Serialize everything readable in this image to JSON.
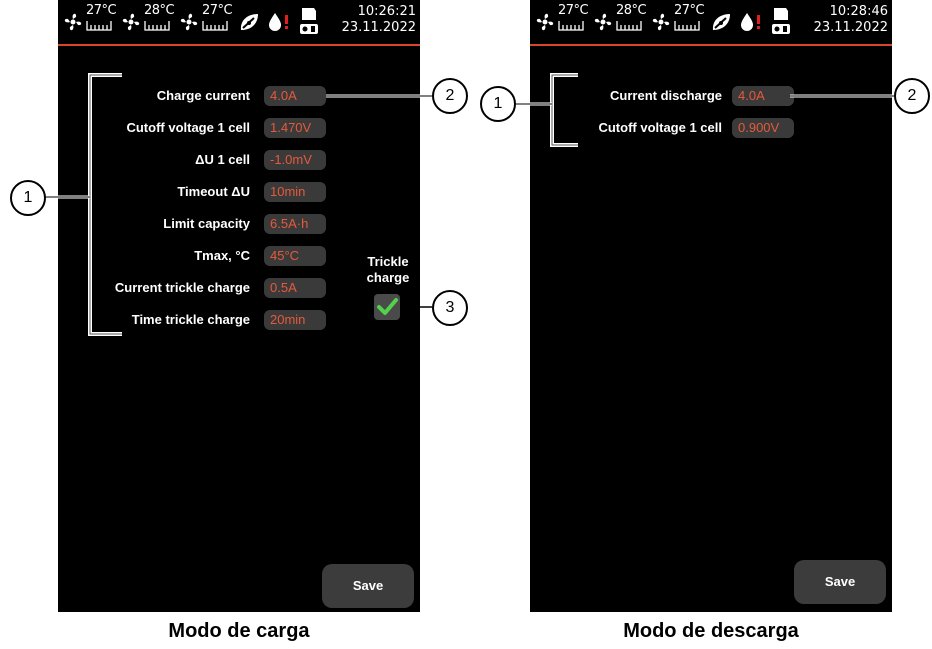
{
  "left": {
    "status": {
      "temps": [
        "27°C",
        "28°C",
        "27°C"
      ],
      "time": "10:26:21",
      "date": "23.11.2022"
    },
    "rows": [
      {
        "label": "Charge current",
        "value": "4.0A"
      },
      {
        "label": "Cutoff voltage 1 cell",
        "value": "1.470V"
      },
      {
        "label": "ΔU 1 cell",
        "value": "-1.0mV"
      },
      {
        "label": "Timeout ΔU",
        "value": "10min"
      },
      {
        "label": "Limit capacity",
        "value": "6.5A·h"
      },
      {
        "label": "Tmax, °C",
        "value": "45°C"
      },
      {
        "label": "Current trickle charge",
        "value": "0.5A"
      },
      {
        "label": "Time trickle charge",
        "value": "20min"
      }
    ],
    "trickle": {
      "line1": "Trickle",
      "line2": "charge",
      "checked": true
    },
    "save_label": "Save",
    "callouts": [
      "1",
      "2",
      "3"
    ],
    "caption": "Modo de carga"
  },
  "right": {
    "status": {
      "temps": [
        "27°C",
        "28°C",
        "27°C"
      ],
      "time": "10:28:46",
      "date": "23.11.2022"
    },
    "rows": [
      {
        "label": "Current discharge",
        "value": "4.0A"
      },
      {
        "label": "Cutoff voltage 1 cell",
        "value": "0.900V"
      }
    ],
    "save_label": "Save",
    "callouts": [
      "1",
      "2"
    ],
    "caption": "Modo de descarga"
  },
  "colors": {
    "accent": "#d9452b",
    "value_text": "#e65a3a",
    "value_bg": "#3a3a3a",
    "check": "#52d14a"
  }
}
